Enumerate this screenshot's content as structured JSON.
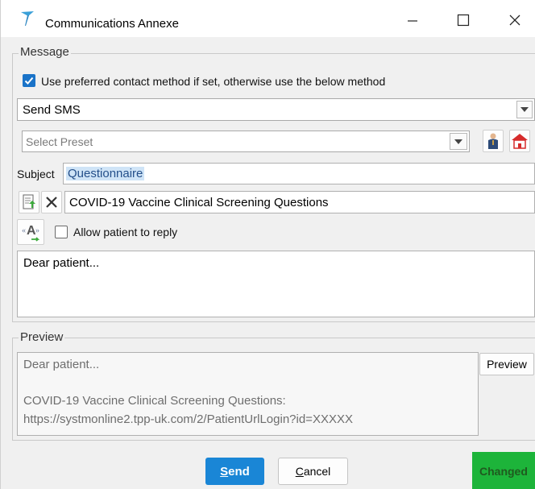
{
  "window": {
    "title": "Communications Annexe",
    "minimize_icon": "minimize-icon",
    "maximize_icon": "maximize-icon",
    "close_icon": "close-icon"
  },
  "message": {
    "group_label": "Message",
    "preferred_contact_label": "Use preferred contact method if set, otherwise use the below method",
    "preferred_contact_checked": true,
    "method_value": "Send SMS",
    "preset_placeholder": "Select Preset",
    "subject_label": "Subject",
    "subject_value": "Questionnaire",
    "questionnaire_value": "COVID-19 Vaccine Clinical Screening Questions",
    "allow_reply_label": "Allow patient to reply",
    "allow_reply_checked": false,
    "body_text": "Dear patient..."
  },
  "preview": {
    "group_label": "Preview",
    "line1": "Dear patient...",
    "line2": "COVID-19 Vaccine Clinical Screening Questions:",
    "line3": "https://systmonline2.tpp-uk.com/2/PatientUrlLogin?id=XXXXX",
    "preview_button": "Preview"
  },
  "footer": {
    "send_label": "Send",
    "send_mnemonic": "S",
    "send_rest": "end",
    "cancel_mnemonic": "C",
    "cancel_rest": "ancel",
    "changed_label": "Changed"
  },
  "colors": {
    "accent": "#1a73c8",
    "send_button": "#1a86d6",
    "changed_bg": "#1db43a",
    "subject_highlight": "#cfe4f7"
  }
}
